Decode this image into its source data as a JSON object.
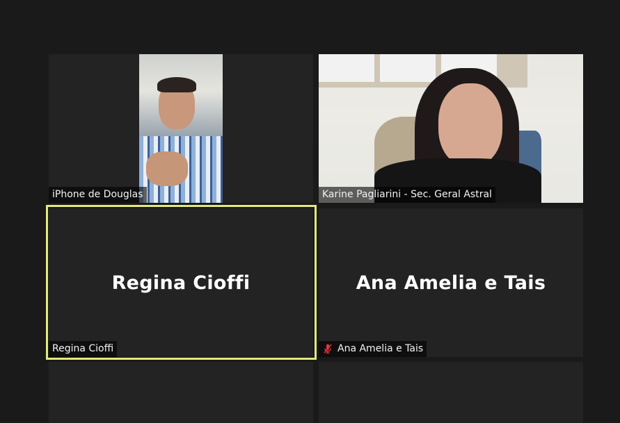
{
  "participants": [
    {
      "name": "iPhone de Douglas",
      "video": true
    },
    {
      "name": "Karine Pagliarini - Sec. Geral Astral",
      "video": true
    },
    {
      "name": "Regina Cioffi",
      "display_name": "Regina Cioffi",
      "video": false,
      "active_speaker": true
    },
    {
      "name": "Ana Amelia e Tais",
      "display_name": "Ana Amelia e Tais",
      "video": false,
      "muted": true
    }
  ],
  "icons": {
    "mute": "microphone-muted-icon"
  },
  "colors": {
    "background": "#1a1a1a",
    "tile": "#232323",
    "active_speaker_border": "#e3e97a",
    "mute_icon": "#e0383e",
    "name_text": "#f2f2f2"
  }
}
